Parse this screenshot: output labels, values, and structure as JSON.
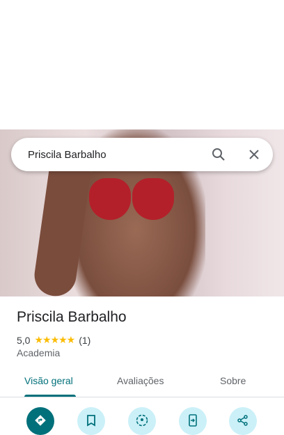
{
  "search": {
    "value": "Priscila Barbalho"
  },
  "place": {
    "name": "Priscila Barbalho",
    "rating": "5,0",
    "stars": "★★★★★",
    "review_count": "(1)",
    "category": "Academia"
  },
  "tabs": [
    {
      "label": "Visão geral",
      "active": true
    },
    {
      "label": "Avaliações"
    },
    {
      "label": "Sobre"
    }
  ],
  "actions": [
    "directions-icon",
    "bookmark-icon",
    "nearby-icon",
    "send-to-phone-icon",
    "share-icon"
  ],
  "colors": {
    "accent": "#00707a",
    "action_bg": "#cbf0f8",
    "star": "#fbbc04"
  }
}
